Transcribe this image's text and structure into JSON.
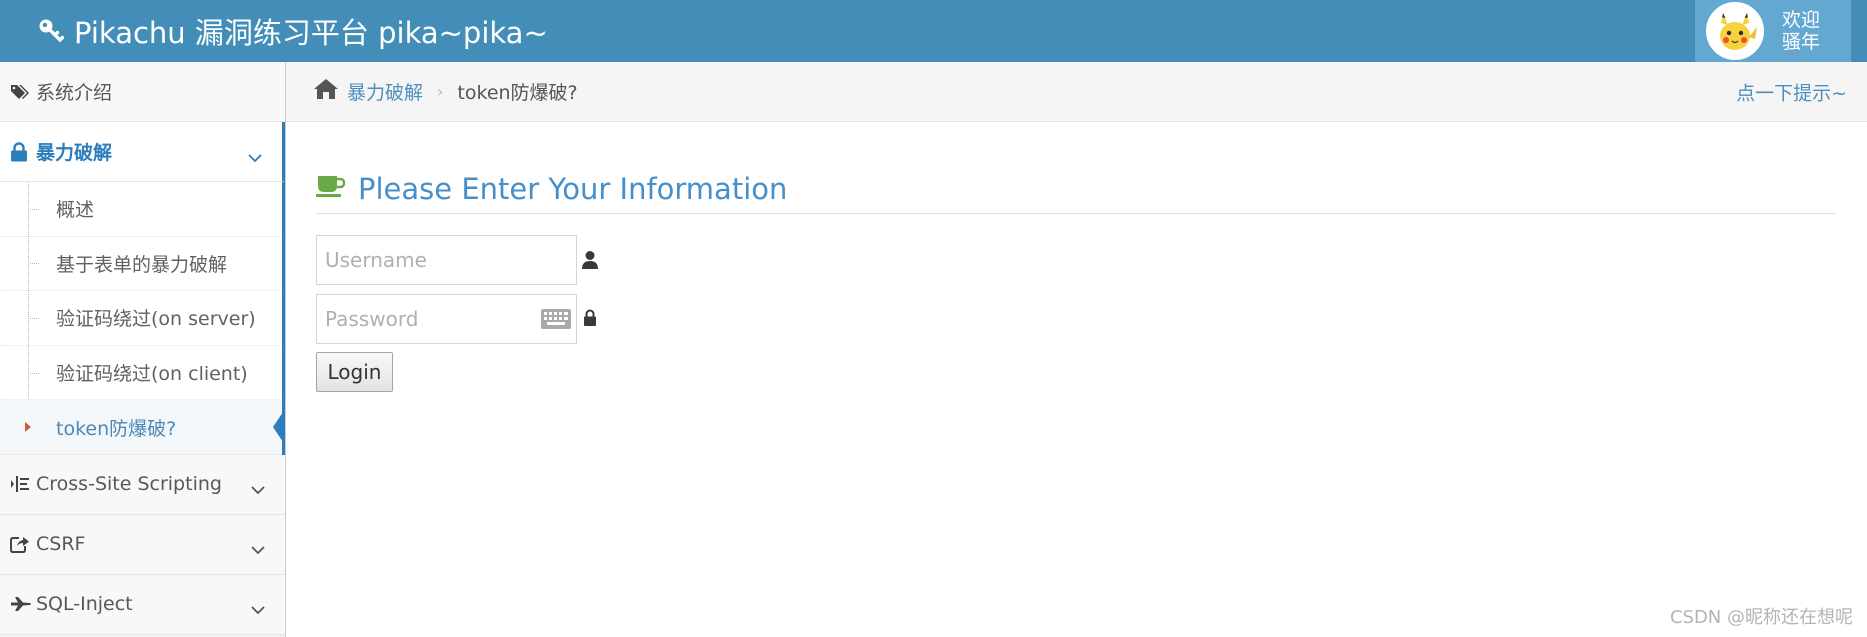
{
  "header": {
    "brand": "Pikachu 漏洞练习平台 pika~pika~",
    "user_greeting_line1": "欢迎",
    "user_greeting_line2": "骚年"
  },
  "sidebar": {
    "items": [
      {
        "label": "系统介绍",
        "icon": "tags-icon"
      },
      {
        "label": "暴力破解",
        "icon": "lock-icon",
        "expanded": true,
        "children": [
          {
            "label": "概述"
          },
          {
            "label": "基于表单的暴力破解"
          },
          {
            "label": "验证码绕过(on server)"
          },
          {
            "label": "验证码绕过(on client)"
          },
          {
            "label": "token防爆破?",
            "active": true
          }
        ]
      },
      {
        "label": "Cross-Site Scripting",
        "icon": "indent-icon"
      },
      {
        "label": "CSRF",
        "icon": "share-icon"
      },
      {
        "label": "SQL-Inject",
        "icon": "fighter-jet-icon"
      }
    ]
  },
  "breadcrumbs": {
    "parent": "暴力破解",
    "current": "token防爆破?",
    "hint": "点一下提示~"
  },
  "form": {
    "title": "Please Enter Your Information",
    "username_placeholder": "Username",
    "username_value": "",
    "password_placeholder": "Password",
    "password_value": "",
    "submit_label": "Login"
  },
  "watermark": "CSDN @昵称还在想呢",
  "colors": {
    "navbar": "#438eb9",
    "user_box": "#62a8d1",
    "accent": "#2b7dbc",
    "title": "#478fca",
    "active_caret": "#c86139"
  }
}
